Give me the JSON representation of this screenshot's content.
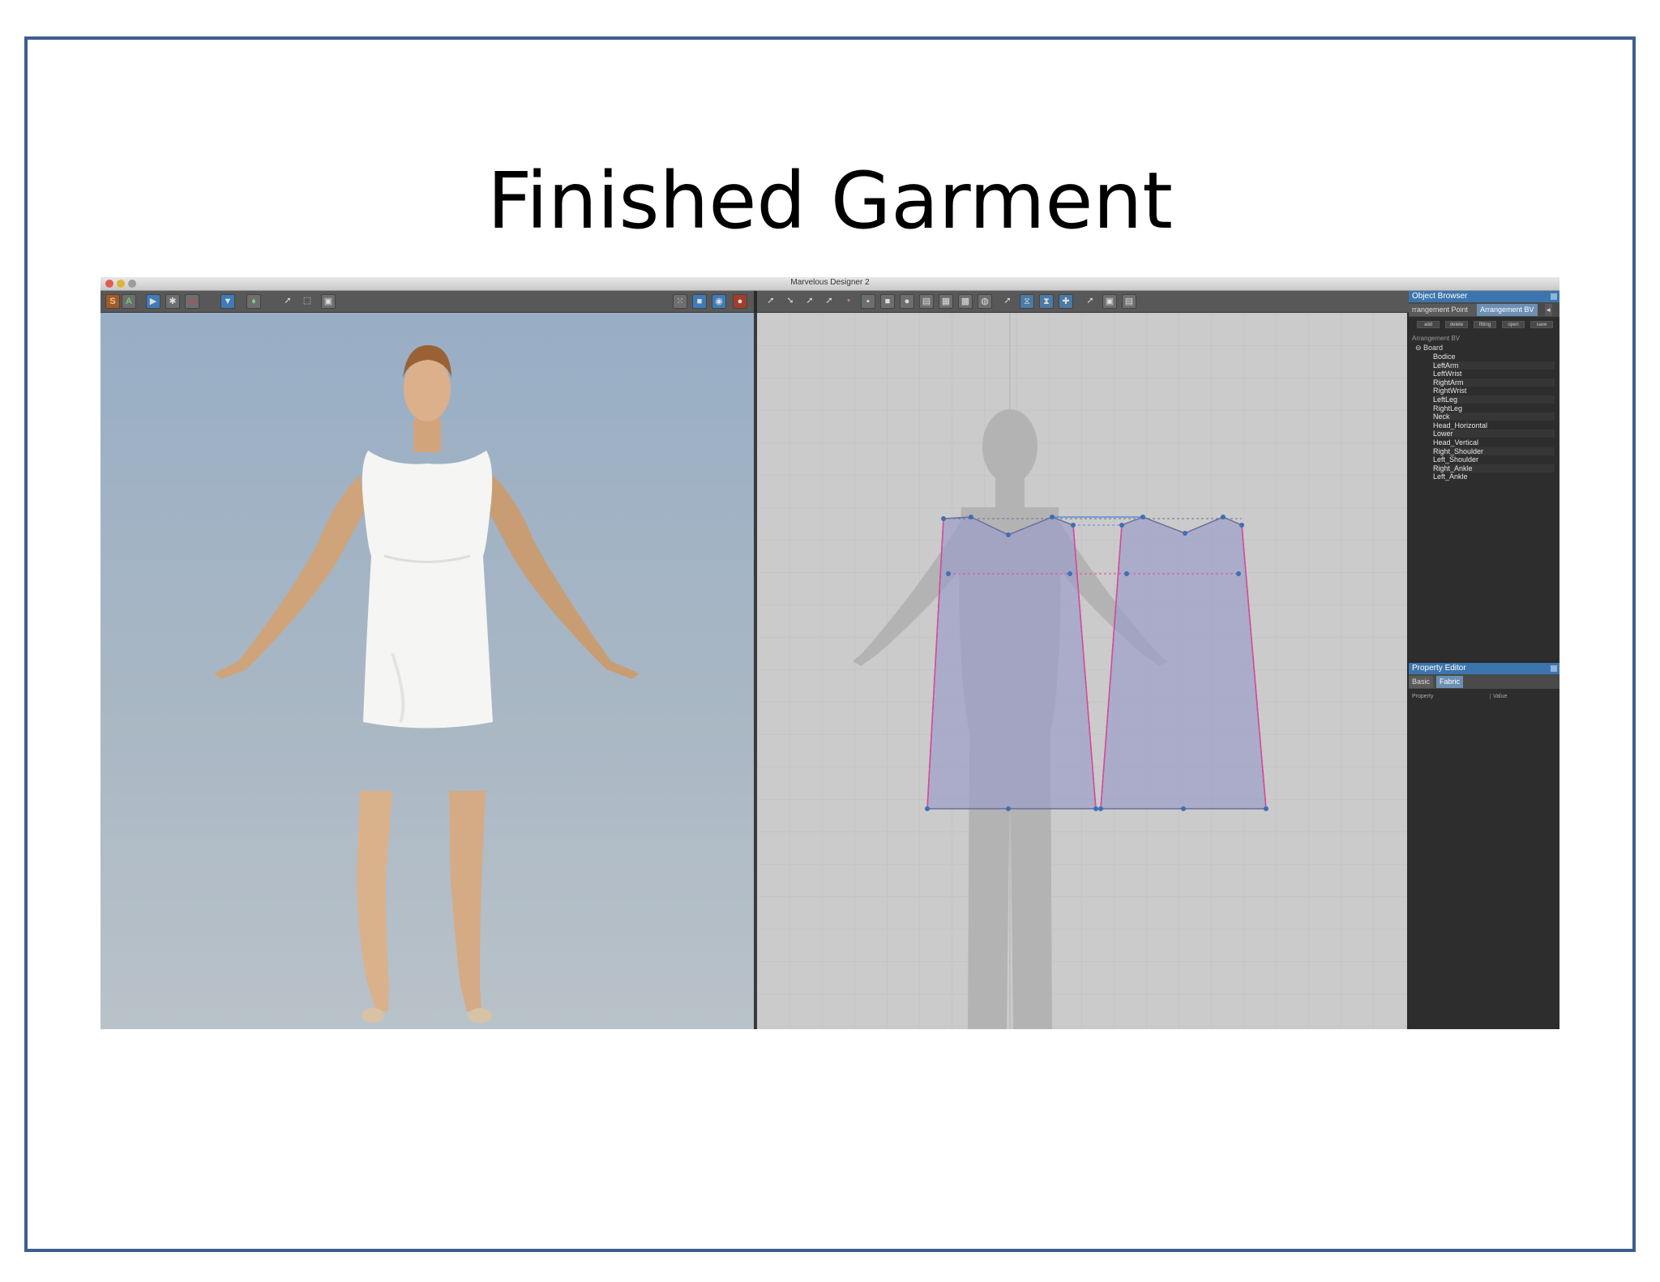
{
  "slide": {
    "title": "Finished Garment"
  },
  "app": {
    "window_title": "Marvelous Designer 2"
  },
  "toolbar_left": {
    "simulate_label": "S",
    "animate_label": "A"
  },
  "object_browser": {
    "title": "Object Browser",
    "tabs": [
      "rrangement Point",
      "Arrangement BV"
    ],
    "buttons": [
      "add",
      "delete",
      "fitting",
      "open",
      "save"
    ],
    "section_label": "Arrangement BV",
    "root": "Board",
    "items": [
      "Bodice",
      "LeftArm",
      "LeftWrist",
      "RightArm",
      "RightWrist",
      "LeftLeg",
      "RightLeg",
      "Neck",
      "Head_Horizontal",
      "Lower",
      "Head_Vertical",
      "Right_Shoulder",
      "Left_Shoulder",
      "Right_Ankle",
      "Left_Ankle"
    ]
  },
  "property_editor": {
    "title": "Property Editor",
    "tabs": [
      "Basic",
      "Fabric"
    ],
    "columns": [
      "Property",
      "Value"
    ]
  },
  "colors": {
    "frame_border": "#3d5f8f",
    "panel_header": "#3c75ad",
    "pattern_fill": "#9c9ec8",
    "seam_line": "#e0479a",
    "point": "#3e6fb5"
  },
  "icons": {
    "close": "close-icon",
    "collapse": "minus-icon",
    "play": "play-icon",
    "record": "record-icon",
    "shirt": "shirt-icon",
    "avatar": "avatar-icon",
    "select": "arrow-cursor-icon"
  }
}
